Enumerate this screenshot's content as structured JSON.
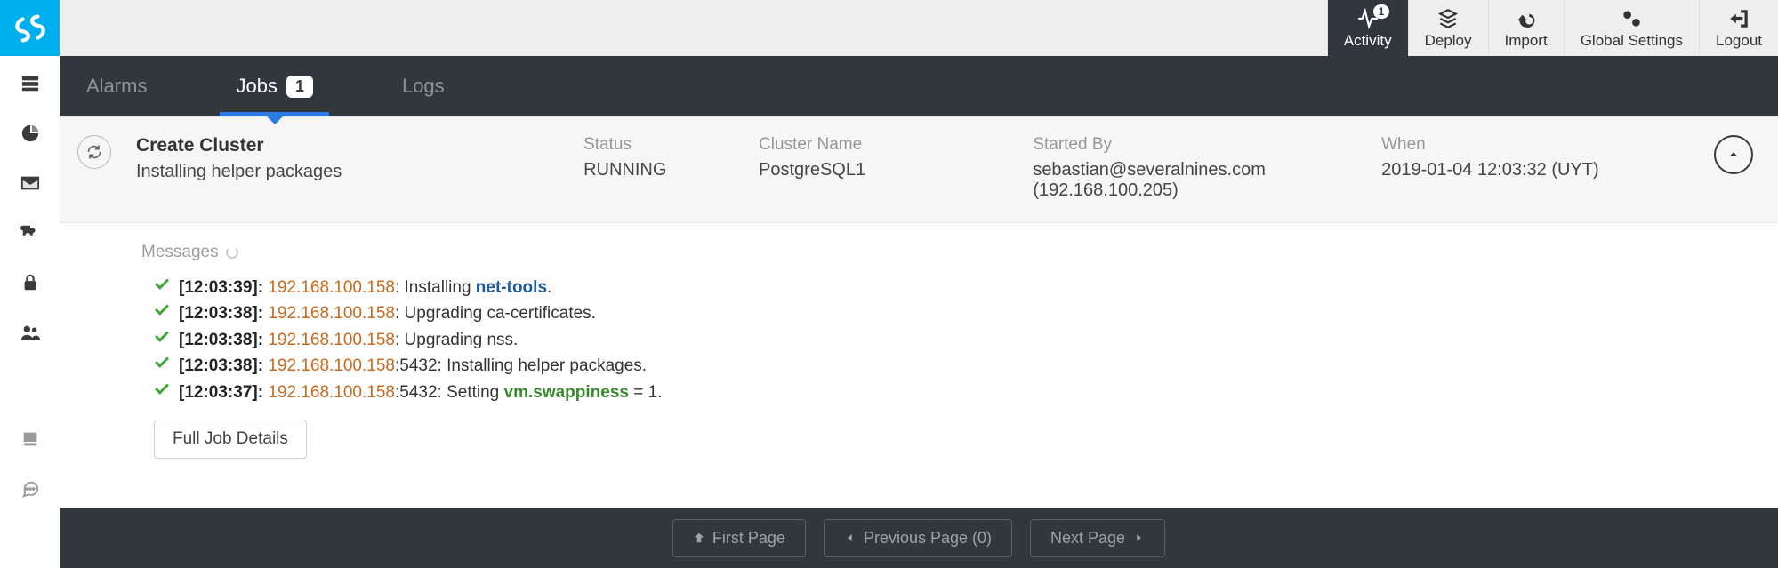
{
  "header": {
    "activity": {
      "label": "Activity",
      "badge": "1"
    },
    "deploy": "Deploy",
    "import": "Import",
    "settings": "Global Settings",
    "logout": "Logout"
  },
  "tabs": {
    "alarms": "Alarms",
    "jobs": {
      "label": "Jobs",
      "count": "1"
    },
    "logs": "Logs"
  },
  "summary": {
    "title": "Create Cluster",
    "subtitle": "Installing helper packages",
    "cols": {
      "status": {
        "label": "Status",
        "value": "RUNNING"
      },
      "cluster": {
        "label": "Cluster Name",
        "value": "PostgreSQL1"
      },
      "started": {
        "label": "Started By",
        "value": "sebastian@severalnines.com (192.168.100.205)"
      },
      "when": {
        "label": "When",
        "value": "2019-01-04 12:03:32 (UYT)"
      }
    }
  },
  "messages_title": "Messages",
  "messages": [
    {
      "ts": "[12:03:39]",
      "ip": "192.168.100.158",
      "sep": ": ",
      "pre": "Installing ",
      "kw": "net-tools",
      "kwcls": "kw-blue",
      "post": "."
    },
    {
      "ts": "[12:03:38]",
      "ip": "192.168.100.158",
      "sep": ": ",
      "pre": "Upgrading ca-certificates.",
      "kw": "",
      "kwcls": "",
      "post": ""
    },
    {
      "ts": "[12:03:38]",
      "ip": "192.168.100.158",
      "sep": ": ",
      "pre": "Upgrading nss.",
      "kw": "",
      "kwcls": "",
      "post": ""
    },
    {
      "ts": "[12:03:38]",
      "ip": "192.168.100.158",
      "sep": ":5432: ",
      "pre": "Installing helper packages.",
      "kw": "",
      "kwcls": "",
      "post": ""
    },
    {
      "ts": "[12:03:37]",
      "ip": "192.168.100.158",
      "sep": ":5432: ",
      "pre": "Setting ",
      "kw": "vm.swappiness",
      "kwcls": "kw-green",
      "post": " = 1."
    }
  ],
  "details_btn": "Full Job Details",
  "footer": {
    "first": "First Page",
    "prev": "Previous Page (0)",
    "next": "Next Page"
  }
}
